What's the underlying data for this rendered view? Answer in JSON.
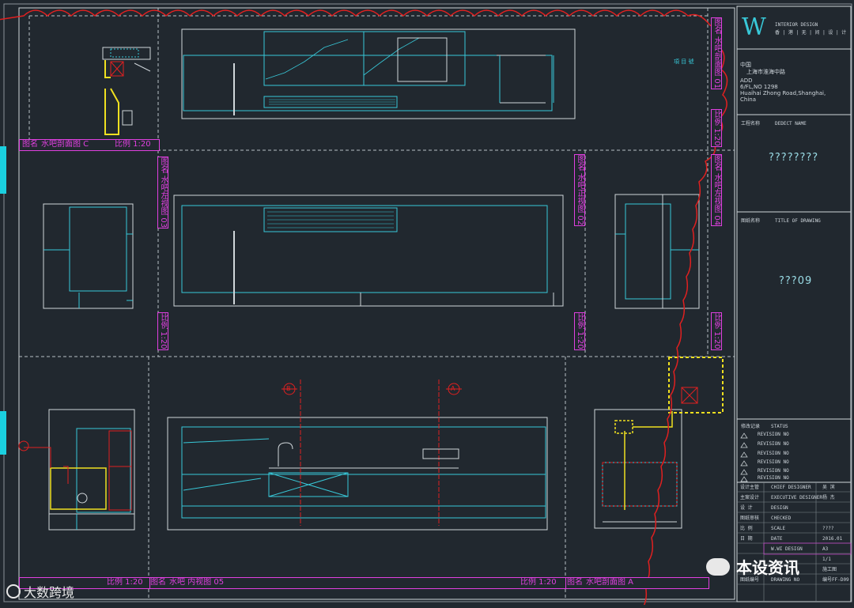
{
  "sheet": {
    "views": [
      {
        "title": "图名",
        "name": "水吧剖面图 C",
        "scale": "比例 1:20"
      },
      {
        "title": "图名",
        "name": "水吧左视图 03",
        "scale": "比例 1:20"
      },
      {
        "title": "图名",
        "name": "水吧正视图 02",
        "scale": "比例 1:20"
      },
      {
        "title": "图名",
        "name": "水吧左视图 04",
        "scale": "比例 1:20"
      },
      {
        "title": "图名",
        "name": "水吧剖面图 01",
        "scale": "比例 1:20"
      },
      {
        "title": "图名",
        "name": "水吧 内视图 05",
        "scale": "比例 1:20"
      },
      {
        "title": "图名",
        "name": "水吧剖面图 A",
        "scale": "比例 1:20"
      },
      {
        "title": "图名",
        "name": "水吧剖面图 B",
        "scale": "比例 1:20"
      }
    ],
    "section_markers": [
      "B",
      "A"
    ]
  },
  "title_block": {
    "logo_letter": "W",
    "logo_sub": "INTERIOR DESIGN",
    "logo_cn": "香 | 港 | 无 | 间 | 设 | 计",
    "address_cn_1": "中国",
    "address_cn_2": "上海市淮海中路",
    "address_en_1": "ADD",
    "address_en_2": "6/FL,NO 1298",
    "address_en_3": "Huaihai Zhong Road,Shanghai,",
    "address_en_4": "China",
    "side_label": "項 目 號",
    "project_label_cn": "工程名称",
    "project_label_en": "DEDECT NAME",
    "project_value": "????????",
    "drawing_label_cn": "图纸名称",
    "drawing_label_en": "TITLE OF DRAWING",
    "drawing_value": "???09",
    "status_cn": "修改记录",
    "status_en": "STATUS",
    "revisions": [
      "REVISION NO",
      "REVISION NO",
      "REVISION NO",
      "REVISION NO",
      "REVISION NO",
      "REVISION NO"
    ],
    "rows": [
      {
        "cn": "设计主管",
        "en": "CHIEF DESIGNER",
        "val": "吴  滨"
      },
      {
        "cn": "主案设计",
        "en": "EXECUTIVE DESIGNER",
        "val": "杨  杰"
      },
      {
        "cn": "设  计",
        "en": "DESIGN",
        "val": ""
      },
      {
        "cn": "图纸审核",
        "en": "CHECKED",
        "val": ""
      },
      {
        "cn": "比  例",
        "en": "SCALE",
        "val": "????"
      },
      {
        "cn": "日  期",
        "en": "DATE",
        "val": "2016.01"
      },
      {
        "cn": "",
        "en": "W.WI DESIGN",
        "val": "A3"
      },
      {
        "cn": "",
        "en": "",
        "val": "1/1"
      },
      {
        "cn": "",
        "en": "",
        "val": "施工图"
      },
      {
        "cn": "图纸编号",
        "en": "DRAWING NO",
        "val": "编号FF-D09"
      }
    ]
  },
  "watermarks": {
    "left": "大数跨境",
    "right": "本设资讯"
  },
  "colors": {
    "background": "#21282f",
    "frame": "#d0d6da",
    "cyan": "#38c8d8",
    "magenta": "#e040e0",
    "red": "#e02020",
    "yellow": "#f0e020"
  }
}
